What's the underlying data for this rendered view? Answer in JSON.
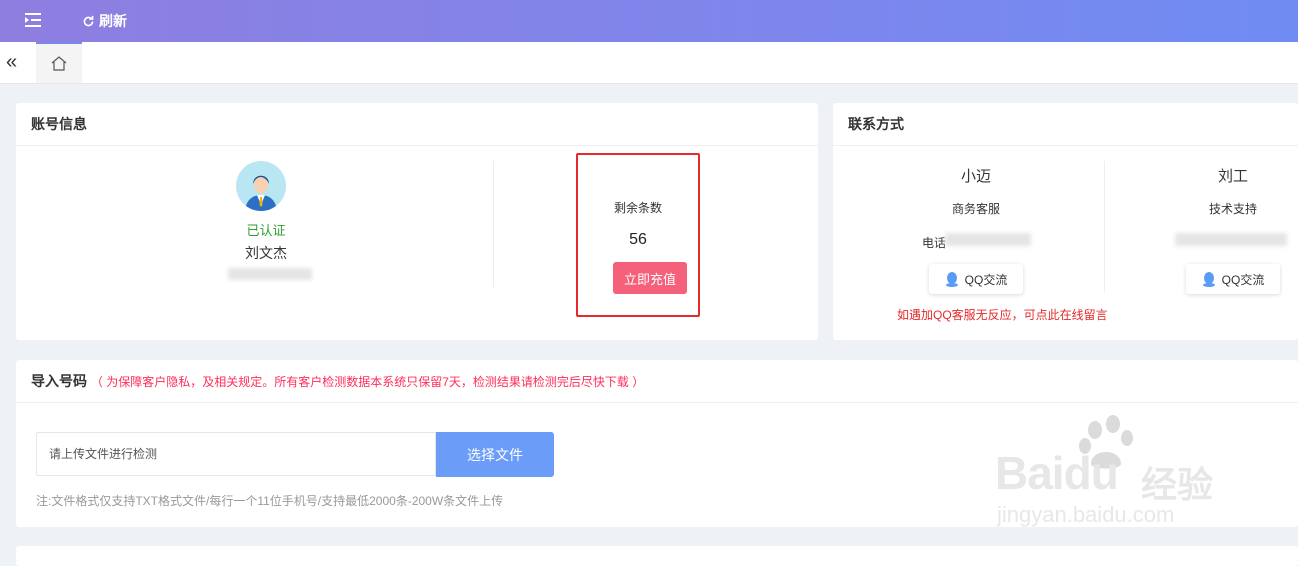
{
  "topbar": {
    "refresh_label": "刷新"
  },
  "account": {
    "title": "账号信息",
    "verified": "已认证",
    "name": "刘文杰",
    "remaining_label": "剩余条数",
    "remaining_count": "56",
    "recharge_label": "立即充值"
  },
  "contact": {
    "title": "联系方式",
    "people": [
      {
        "name": "小迈",
        "role": "商务客服",
        "phone_label": "电话",
        "qq_label": "QQ交流"
      },
      {
        "name": "刘工",
        "role": "技术支持",
        "qq_label": "QQ交流"
      }
    ],
    "note": "如遇加QQ客服无反应，可点此在线留言"
  },
  "import": {
    "title": "导入号码",
    "notice": "（ 为保障客户隐私，及相关规定。所有客户检测数据本系统只保留7天，检测结果请检测完后尽快下载 ）",
    "input_placeholder": "请上传文件进行检测",
    "choose_label": "选择文件",
    "hint": "注:文件格式仅支持TXT格式文件/每行一个11位手机号/支持最低2000条-200W条文件上传"
  },
  "watermark": {
    "brand": "Bai",
    "brand2": "du",
    "cn": "经验",
    "url": "jingyan.baidu.com"
  },
  "colors": {
    "accent": "#7e86ec",
    "recharge": "#f5607a",
    "choose": "#6a9cf8",
    "alert": "#e52a2a"
  }
}
